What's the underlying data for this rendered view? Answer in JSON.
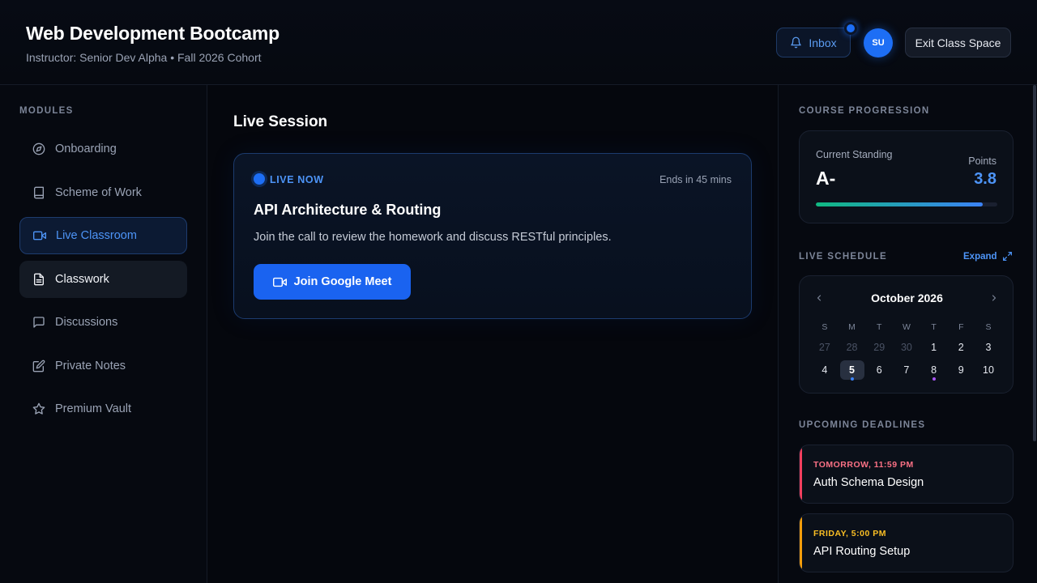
{
  "header": {
    "title": "Web Development Bootcamp",
    "subtitle": "Instructor: Senior Dev Alpha • Fall 2026 Cohort",
    "inbox_label": "Inbox",
    "avatar_initials": "SU",
    "exit_label": "Exit Class Space"
  },
  "sidebar": {
    "section_label": "MODULES",
    "items": [
      {
        "label": "Onboarding",
        "icon": "compass-icon"
      },
      {
        "label": "Scheme of Work",
        "icon": "book-icon"
      },
      {
        "label": "Live Classroom",
        "icon": "video-icon",
        "state": "active"
      },
      {
        "label": "Classwork",
        "icon": "file-text-icon",
        "state": "hover"
      },
      {
        "label": "Discussions",
        "icon": "message-icon"
      },
      {
        "label": "Private Notes",
        "icon": "edit-icon"
      },
      {
        "label": "Premium Vault",
        "icon": "star-icon"
      }
    ]
  },
  "main": {
    "title": "Live Session",
    "live_card": {
      "status": "LIVE NOW",
      "ends": "Ends in 45 mins",
      "title": "API Architecture & Routing",
      "description": "Join the call to review the homework and discuss RESTful principles.",
      "button_label": "Join Google Meet"
    }
  },
  "right": {
    "progression": {
      "section_label": "COURSE PROGRESSION",
      "standing_label": "Current Standing",
      "standing_value": "A-",
      "points_label": "Points",
      "points_value": "3.8",
      "progress_fraction": 0.92
    },
    "schedule": {
      "section_label": "LIVE SCHEDULE",
      "expand_label": "Expand",
      "month": "October 2026",
      "weekdays": [
        "S",
        "M",
        "T",
        "W",
        "T",
        "F",
        "S"
      ],
      "weeks": [
        [
          {
            "d": "27",
            "muted": true
          },
          {
            "d": "28",
            "muted": true
          },
          {
            "d": "29",
            "muted": true
          },
          {
            "d": "30",
            "muted": true
          },
          {
            "d": "1"
          },
          {
            "d": "2"
          },
          {
            "d": "3"
          }
        ],
        [
          {
            "d": "4"
          },
          {
            "d": "5",
            "today": true,
            "event": "blue"
          },
          {
            "d": "6"
          },
          {
            "d": "7"
          },
          {
            "d": "8",
            "event": "purple"
          },
          {
            "d": "9"
          },
          {
            "d": "10"
          }
        ]
      ]
    },
    "deadlines": {
      "section_label": "UPCOMING DEADLINES",
      "items": [
        {
          "when": "TOMORROW, 11:59 PM",
          "title": "Auth Schema Design",
          "color": "#f43f5e"
        },
        {
          "when": "FRIDAY, 5:00 PM",
          "title": "API Routing Setup",
          "color": "#f59e0b"
        }
      ]
    }
  },
  "colors": {
    "accent": "#1d6ef5",
    "accent_text": "#4d94f7",
    "background": "#05070d"
  }
}
